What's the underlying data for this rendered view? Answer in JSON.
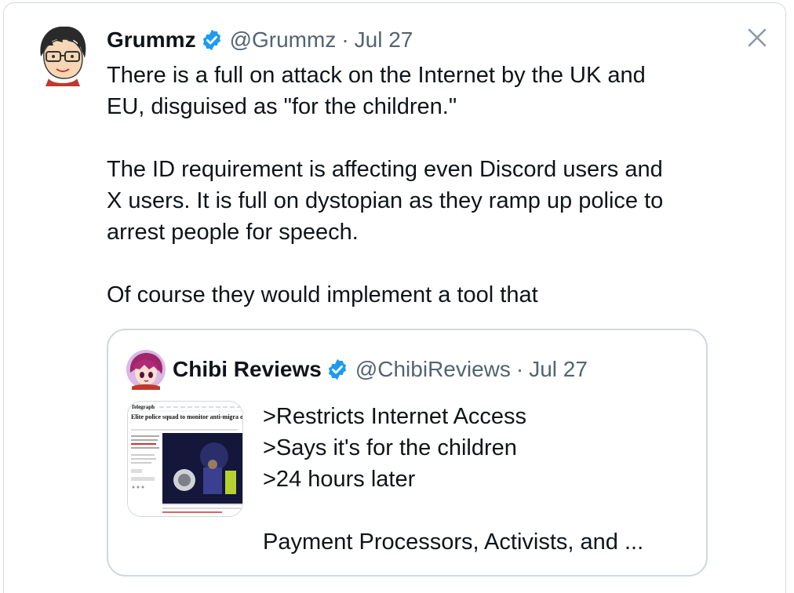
{
  "tweet": {
    "author_name": "Grummz",
    "handle": "@Grummz",
    "separator": "·",
    "date": "Jul 27",
    "text": "There is a full on attack on the Internet by the UK and\nEU, disguised as \"for the children.\"\n\nThe ID requirement is affecting even Discord users and\nX users. It is full on dystopian as they ramp up police to\narrest people for speech.\n\nOf course they would implement a tool that",
    "avatar_icon": "cartoon-avatar-glasses",
    "verified_icon": "verified-badge-icon",
    "close_icon": "close-icon"
  },
  "quote": {
    "author_name": "Chibi Reviews",
    "handle": "@ChibiReviews",
    "separator": "·",
    "date": "Jul 27",
    "text": ">Restricts Internet Access\n>Says it's for the children\n>24 hours later\n\nPayment Processors, Activists, and ...",
    "avatar_icon": "anime-avatar",
    "thumbnail": {
      "masthead": "Telegraph",
      "headline": "Elite police squad to monitor anti-migra on social media"
    }
  },
  "colors": {
    "text": "#0f1419",
    "muted": "#536471",
    "verified": "#1d9bf0",
    "border": "#cfd9de"
  }
}
